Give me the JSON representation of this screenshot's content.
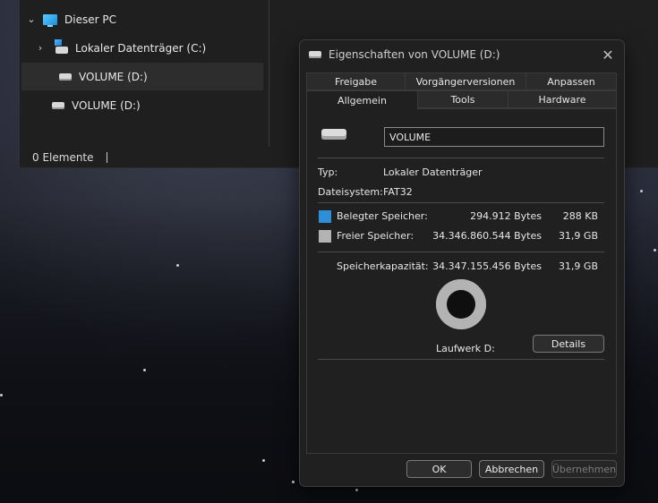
{
  "explorer": {
    "tree": [
      {
        "label": "Dieser PC",
        "expanded": true
      },
      {
        "label": "Lokaler Datenträger (C:)"
      },
      {
        "label": "VOLUME (D:)",
        "selected": true
      },
      {
        "label": "VOLUME (D:)"
      }
    ],
    "status": "0 Elemente"
  },
  "dialog": {
    "title": "Eigenschaften von VOLUME (D:)",
    "tabs_back": [
      "Freigabe",
      "Vorgängerversionen",
      "Anpassen"
    ],
    "tabs_front": [
      "Allgemein",
      "Tools",
      "Hardware"
    ],
    "active_tab": "Allgemein",
    "volume_name": "VOLUME",
    "type_label": "Typ:",
    "type_value": "Lokaler Datenträger",
    "fs_label": "Dateisystem:",
    "fs_value": "FAT32",
    "used_label": "Belegter Speicher:",
    "used_bytes": "294.912 Bytes",
    "used_short": "288 KB",
    "free_label": "Freier Speicher:",
    "free_bytes": "34.346.860.544 Bytes",
    "free_short": "31,9 GB",
    "cap_label": "Speicherkapazität:",
    "cap_bytes": "34.347.155.456 Bytes",
    "cap_short": "31,9 GB",
    "drive_label": "Laufwerk D:",
    "details_button": "Details",
    "ok_button": "OK",
    "cancel_button": "Abbrechen",
    "apply_button": "Übernehmen",
    "used_fraction": 8.6e-06,
    "colors": {
      "used": "#2f8fd6",
      "free": "#b3b3b3"
    }
  }
}
